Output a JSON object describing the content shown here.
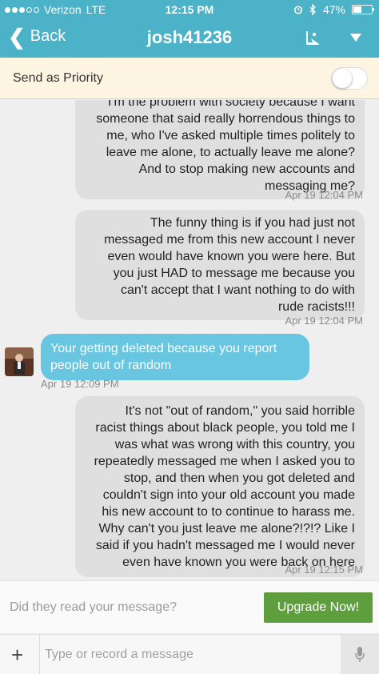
{
  "status_bar": {
    "carrier": "Verizon",
    "network": "LTE",
    "time": "12:15 PM",
    "battery": "47%",
    "battery_level": 0.47
  },
  "nav": {
    "back_label": "Back",
    "title": "josh41236"
  },
  "priority": {
    "label": "Send as Priority",
    "enabled": false
  },
  "messages": [
    {
      "direction": "out",
      "lines": [
        "I'm the problem with society because I want",
        "someone that said really horrendous  things to",
        "me, who I've asked multiple times politely to",
        "leave me alone, to actually leave me alone?",
        "And to stop making new accounts and",
        "messaging me?"
      ],
      "timestamp": "Apr 19 12:04 PM"
    },
    {
      "direction": "out",
      "lines": [
        "The funny thing is if you had just not",
        "messaged me from this new account I never",
        "even would have known you were here. But",
        "you just HAD to message me because you",
        "can't accept that I want nothing to do with",
        "rude racists!!!"
      ],
      "timestamp": "Apr 19 12:04 PM"
    },
    {
      "direction": "in",
      "lines": [
        "Your getting deleted because you report",
        "people out of random"
      ],
      "timestamp": "Apr 19 12:09 PM"
    },
    {
      "direction": "out",
      "lines": [
        "It's not \"out of random,\" you said horrible",
        "racist things about black people, you told me I",
        "was what was wrong with this country, you",
        "repeatedly messaged me when I asked you to",
        "stop, and then when you got deleted and",
        "couldn't sign into your old account you made",
        "his new account to to continue to harass me.",
        "Why can't you just leave me alone?!?!? Like I",
        "said if you hadn't messaged me I would never",
        "even have known you were back on here"
      ],
      "timestamp": "Apr 19 12:15 PM"
    }
  ],
  "footer": {
    "read_prompt": "Did they read your message?",
    "upgrade_label": "Upgrade Now!",
    "input_placeholder": "Type or record a message",
    "plus_glyph": "+"
  },
  "colors": {
    "header": "#4cb2c7",
    "incoming_bubble": "#68c6e1",
    "outgoing_bubble": "#dfdfdf",
    "upgrade_button": "#5e9e3c",
    "priority_bar": "#fdf5e2"
  },
  "icons": {
    "back": "chevron-left-icon",
    "flag": "priority-flag-icon",
    "menu": "caret-down-icon",
    "mic": "microphone-icon",
    "plus": "plus-icon",
    "alarm": "alarm-icon",
    "bluetooth": "bluetooth-icon"
  }
}
